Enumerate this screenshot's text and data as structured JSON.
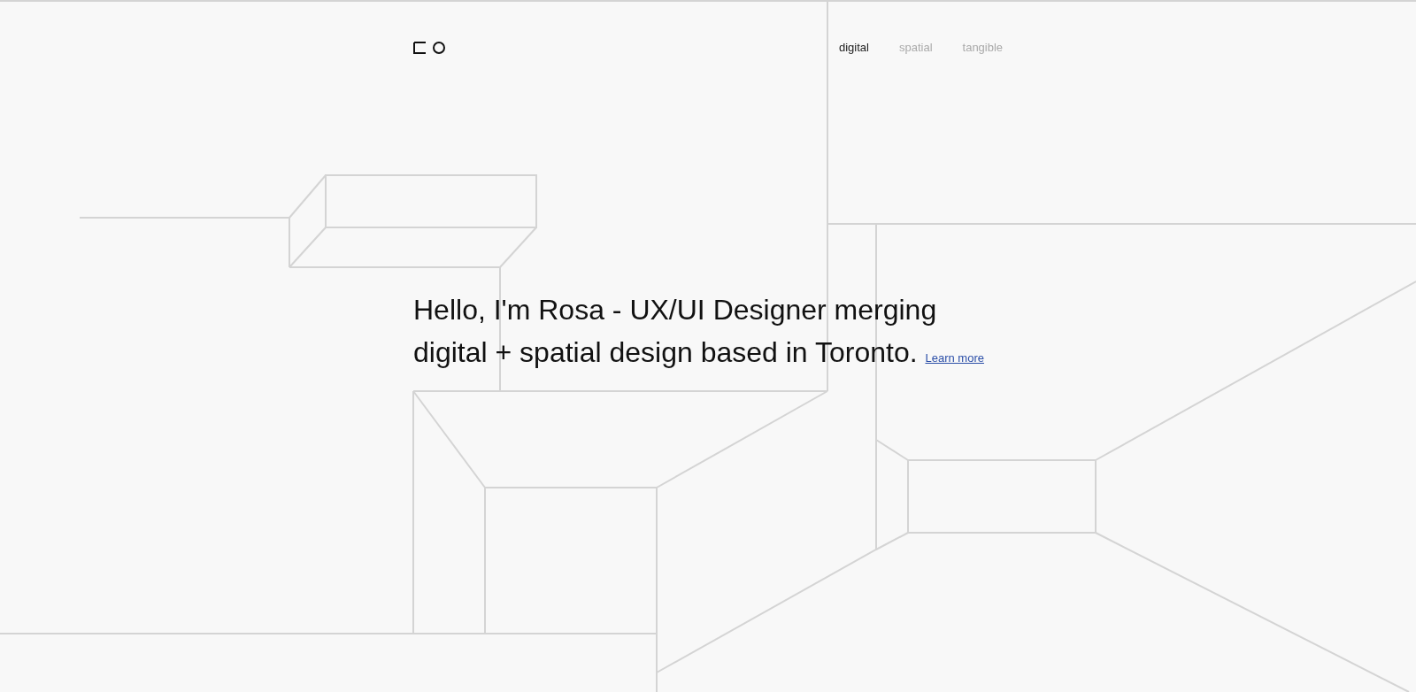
{
  "nav": [
    {
      "label": "digital",
      "selected": true
    },
    {
      "label": "spatial",
      "selected": false
    },
    {
      "label": "tangible",
      "selected": false
    }
  ],
  "hero": {
    "text": "Hello, I'm Rosa - UX/UI Designer merging digital + spatial design based in Toronto.",
    "link": "Learn more"
  }
}
